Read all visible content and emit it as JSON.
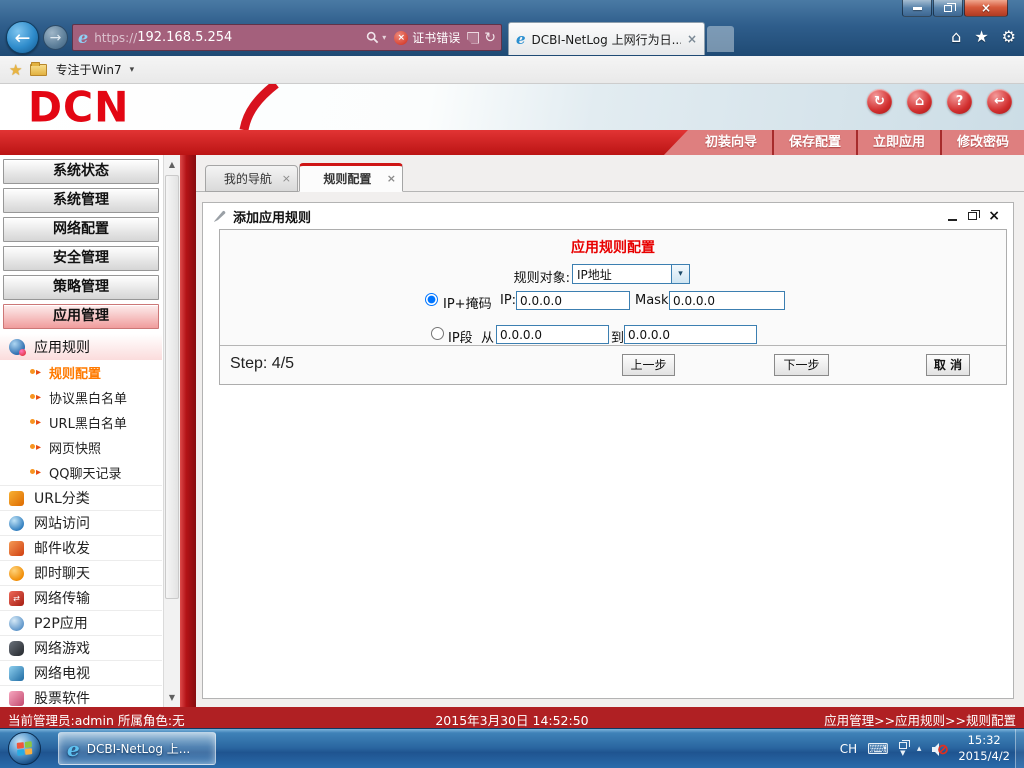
{
  "icons": {
    "back": "←",
    "forward": "→",
    "close": "×",
    "dropdown": "▾",
    "home": "⌂",
    "star": "★",
    "gear": "⚙",
    "refresh": "↻",
    "sync": "↻",
    "help": "?",
    "logout": "↩",
    "scroll_up": "▲",
    "scroll_down": "▼",
    "keyboard": "⌨",
    "tray_up": "▴",
    "transfer_glyph": "⇄",
    "cert_x": "×"
  },
  "browser": {
    "address": {
      "scheme": "https://",
      "host": "192.168.5.254",
      "cert_error": "证书错误"
    },
    "tab_title": "DCBI-NetLog 上网行为日...",
    "favorites_label": "专注于Win7"
  },
  "banner": {
    "logo": "DCN"
  },
  "band_buttons": [
    "初装向导",
    "保存配置",
    "立即应用",
    "修改密码"
  ],
  "sidebar": {
    "main": [
      "系统状态",
      "系统管理",
      "网络配置",
      "安全管理",
      "策略管理",
      "应用管理"
    ],
    "group_label": "应用规则",
    "sub": [
      "规则配置",
      "协议黑白名单",
      "URL黑白名单",
      "网页快照",
      "QQ聊天记录"
    ],
    "items": [
      "URL分类",
      "网站访问",
      "邮件收发",
      "即时聊天",
      "网络传输",
      "P2P应用",
      "网络游戏",
      "网络电视",
      "股票软件"
    ]
  },
  "content": {
    "tabs": [
      {
        "label": "我的导航"
      },
      {
        "label": "规则配置"
      }
    ],
    "dialog": {
      "title": "添加应用规则",
      "form_title": "应用规则配置",
      "rule_object_label": "规则对象:",
      "rule_object_value": "IP地址",
      "mask_option": "IP+掩码",
      "ip_label": "IP:",
      "ip_value": "0.0.0.0",
      "mask_label": "Mask:",
      "mask_value": "0.0.0.0",
      "range_option": "IP段",
      "from_label": "从",
      "from_value": "0.0.0.0",
      "to_label": "到",
      "to_value": "0.0.0.0",
      "step": "Step: 4/5",
      "prev": "上一步",
      "next": "下一步",
      "cancel": "取 消"
    }
  },
  "statusbar": {
    "admin": "当前管理员:admin  所属角色:无",
    "datetime": "2015年3月30日 14:52:50",
    "breadcrumb": "应用管理>>应用规则>>规则配置"
  },
  "taskbar": {
    "ie_button": "DCBI-NetLog 上...",
    "lang": "CH",
    "time": "15:32",
    "date": "2015/4/2"
  }
}
